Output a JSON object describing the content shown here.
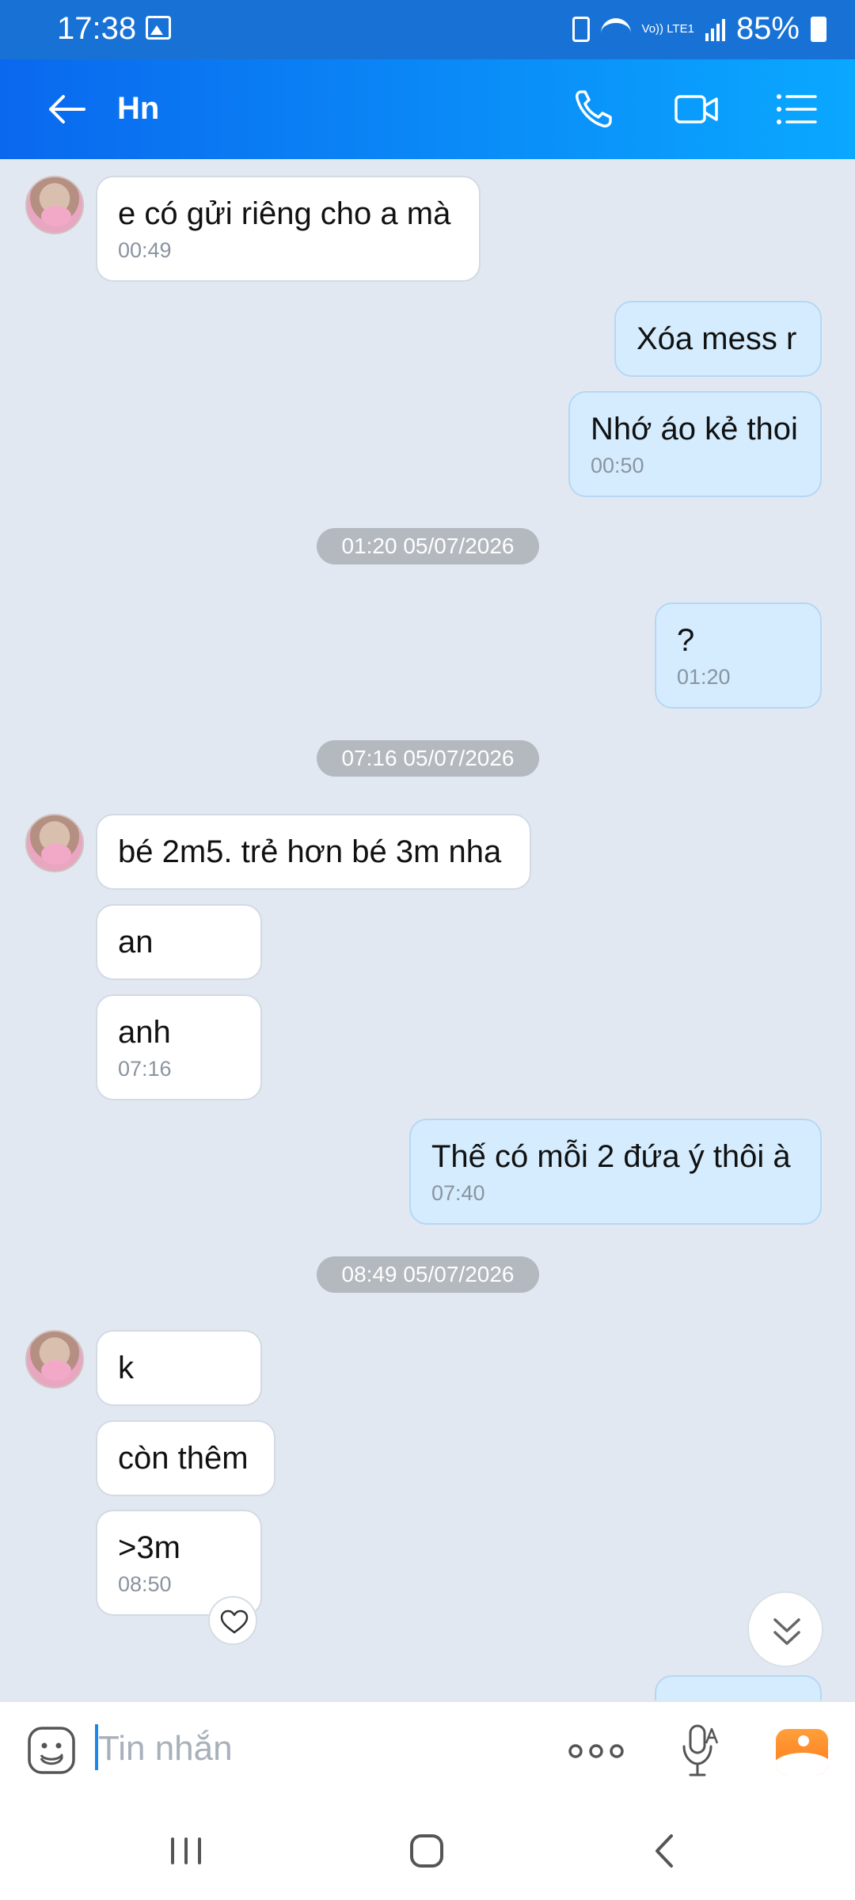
{
  "status_bar": {
    "time": "17:38",
    "network_label": "Vo)) LTE1",
    "battery": "85%"
  },
  "header": {
    "title": "Hn"
  },
  "messages": [
    {
      "text": "e có gửi riêng cho a mà",
      "time": "00:49"
    },
    {
      "text": "Xóa mess r"
    },
    {
      "text": "Nhớ áo kẻ thoi",
      "time": "00:50"
    },
    {
      "text": "?",
      "time": "01:20"
    },
    {
      "text": "bé 2m5. trẻ hơn bé 3m nha"
    },
    {
      "text": "an"
    },
    {
      "text": "anh",
      "time": "07:16"
    },
    {
      "text": "Thế có mỗi 2 đứa ý thôi à",
      "time": "07:40"
    },
    {
      "text": "k"
    },
    {
      "text": "còn thêm"
    },
    {
      "text": ">3m",
      "time": "08:50"
    }
  ],
  "date_separators": [
    "01:20 05/07/2026",
    "07:16 05/07/2026",
    "08:49 05/07/2026"
  ],
  "composer": {
    "placeholder": "Tin nhắn"
  },
  "colors": {
    "header_start": "#0a68ee",
    "header_end": "#0aa8ff",
    "bubble_out": "#d4ecfe",
    "bubble_in": "#ffffff",
    "chat_bg": "#e2e8f1"
  },
  "icons": [
    "back-arrow-icon",
    "phone-icon",
    "video-call-icon",
    "menu-list-icon",
    "heart-icon",
    "chevron-double-down-icon",
    "emoji-icon",
    "more-icon",
    "mic-icon",
    "image-icon"
  ]
}
